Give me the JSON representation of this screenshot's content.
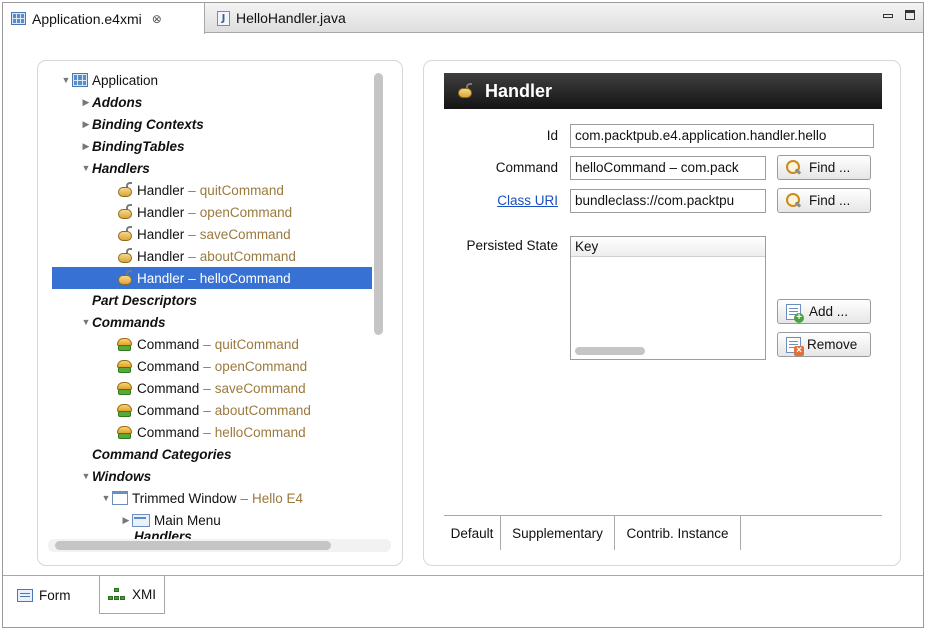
{
  "editor_tabs": [
    {
      "label": "Application.e4xmi",
      "icon": "xmi-file-icon",
      "active": true,
      "close": "⊗"
    },
    {
      "label": "HelloHandler.java",
      "icon": "java-file-icon",
      "active": false
    }
  ],
  "tree": {
    "root": "Application",
    "items": [
      {
        "label": "Addons",
        "expander": "▶"
      },
      {
        "label": "Binding Contexts",
        "expander": "▶"
      },
      {
        "label": "BindingTables",
        "expander": "▶"
      },
      {
        "label": "Handlers",
        "expander": "▼"
      },
      {
        "label": "Part Descriptors"
      },
      {
        "label": "Commands",
        "expander": "▼"
      },
      {
        "label": "Command Categories"
      },
      {
        "label": "Windows",
        "expander": "▼"
      }
    ],
    "handlers": [
      {
        "label": "Handler",
        "sep": "–",
        "detail": "quitCommand"
      },
      {
        "label": "Handler",
        "sep": "–",
        "detail": "openCommand"
      },
      {
        "label": "Handler",
        "sep": "–",
        "detail": "saveCommand"
      },
      {
        "label": "Handler",
        "sep": "–",
        "detail": "aboutCommand"
      },
      {
        "label": "Handler",
        "sep": "–",
        "detail": "helloCommand",
        "selected": true
      }
    ],
    "commands": [
      {
        "label": "Command",
        "sep": "–",
        "detail": "quitCommand"
      },
      {
        "label": "Command",
        "sep": "–",
        "detail": "openCommand"
      },
      {
        "label": "Command",
        "sep": "–",
        "detail": "saveCommand"
      },
      {
        "label": "Command",
        "sep": "–",
        "detail": "aboutCommand"
      },
      {
        "label": "Command",
        "sep": "–",
        "detail": "helloCommand"
      }
    ],
    "window": {
      "label": "Trimmed Window",
      "sep": "–",
      "detail": "Hello E4"
    },
    "main_menu": "Main Menu",
    "window_handlers": "Handlers"
  },
  "detail": {
    "header": "Handler",
    "id_label": "Id",
    "id_value": "com.packtpub.e4.application.handler.hello",
    "command_label": "Command",
    "command_value": "helloCommand – com.pack",
    "class_uri_label": "Class URI",
    "class_uri_value": "bundleclass://com.packtpu",
    "find_label": "Find ...",
    "persisted_state_label": "Persisted State",
    "table_header": "Key",
    "add_label": "Add ...",
    "remove_label": "Remove",
    "sub_tabs": [
      "Default",
      "Supplementary",
      "Contrib. Instance"
    ]
  },
  "page_tabs": [
    {
      "label": "Form",
      "icon": "form-icon",
      "active": false
    },
    {
      "label": "XMI",
      "icon": "xmi-tree-icon",
      "active": true
    }
  ]
}
